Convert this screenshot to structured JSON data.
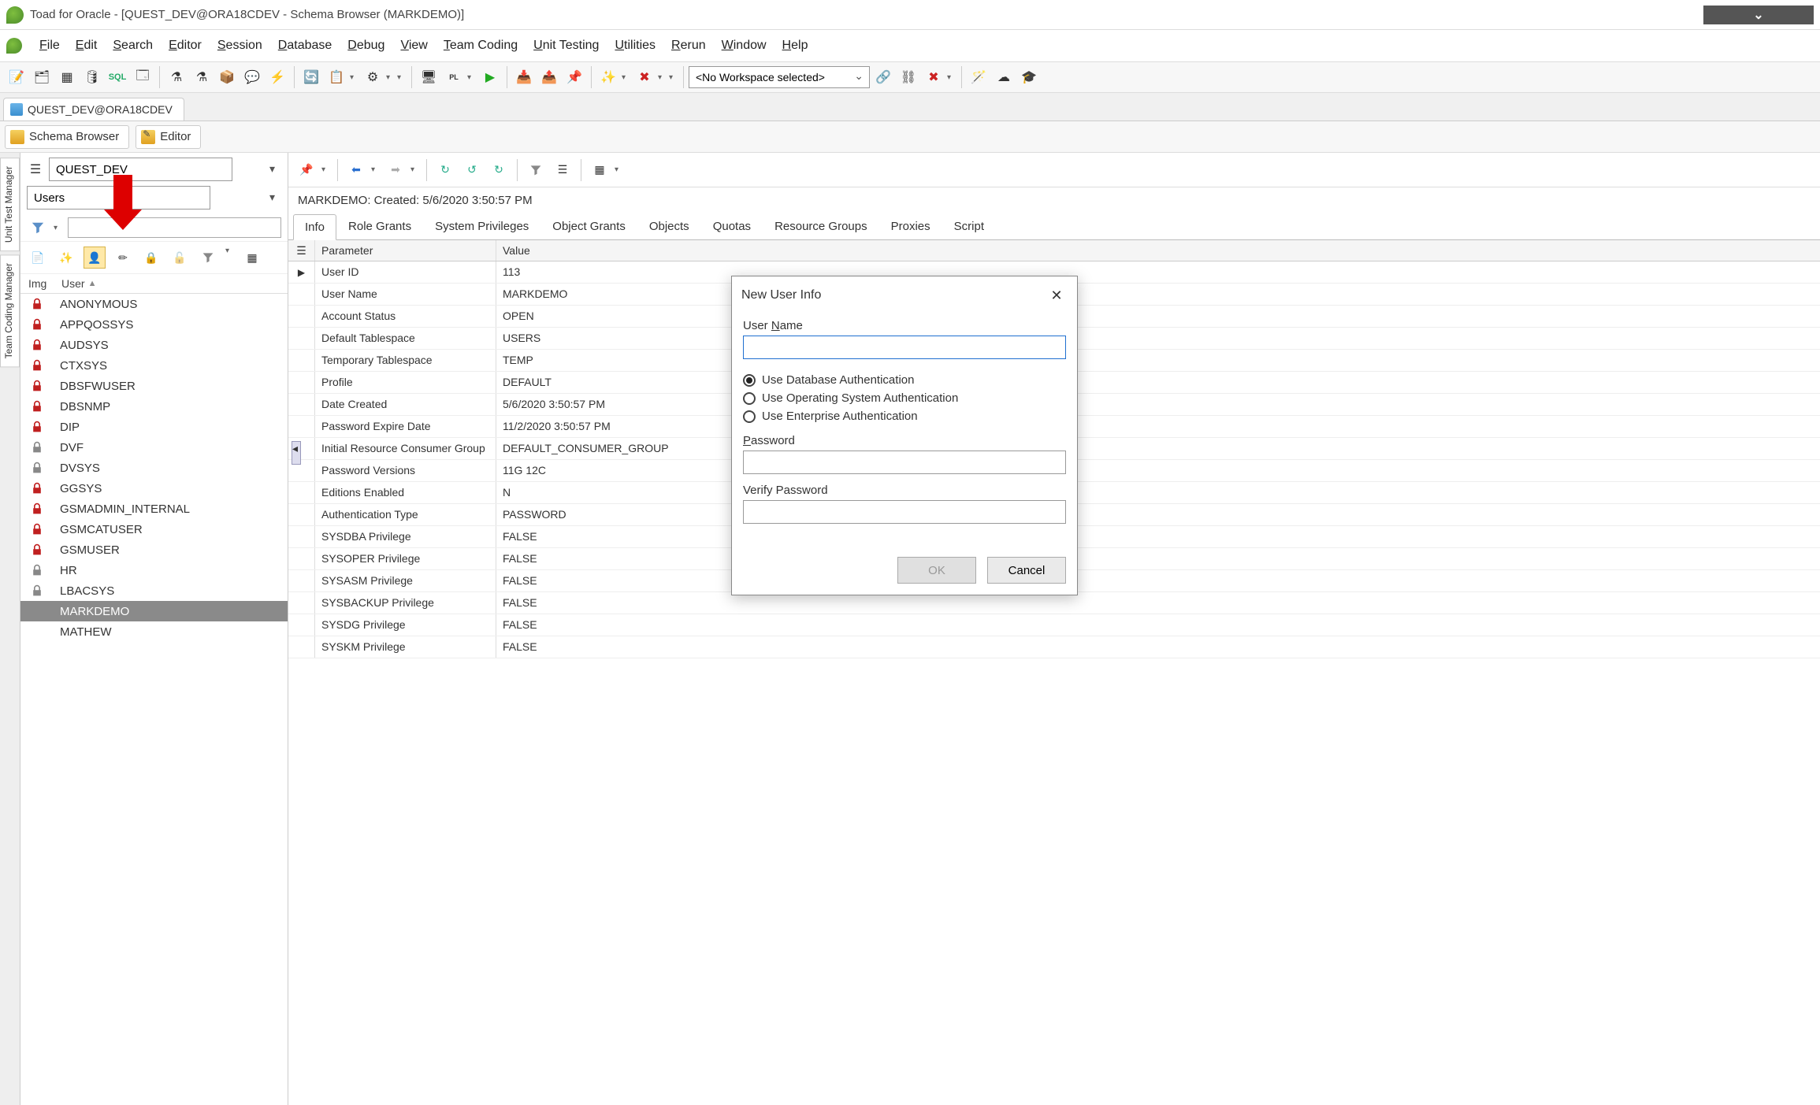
{
  "window": {
    "title": "Toad for Oracle - [QUEST_DEV@ORA18CDEV - Schema Browser (MARKDEMO)]"
  },
  "menu": [
    "File",
    "Edit",
    "Search",
    "Editor",
    "Session",
    "Database",
    "Debug",
    "View",
    "Team Coding",
    "Unit Testing",
    "Utilities",
    "Rerun",
    "Window",
    "Help"
  ],
  "workspace": {
    "selected": "<No Workspace selected>"
  },
  "connection_tab": "QUEST_DEV@ORA18CDEV",
  "sub_tabs": [
    "Schema Browser",
    "Editor"
  ],
  "side_tabs": [
    "Unit Test Manager",
    "Team Coding Manager"
  ],
  "left": {
    "schema_selected": "QUEST_DEV",
    "type_selected": "Users",
    "filter_value": "",
    "columns": {
      "img": "Img",
      "user": "User"
    },
    "users": [
      {
        "name": "ANONYMOUS",
        "lock": "red"
      },
      {
        "name": "APPQOSSYS",
        "lock": "red"
      },
      {
        "name": "AUDSYS",
        "lock": "red"
      },
      {
        "name": "CTXSYS",
        "lock": "red"
      },
      {
        "name": "DBSFWUSER",
        "lock": "red"
      },
      {
        "name": "DBSNMP",
        "lock": "red"
      },
      {
        "name": "DIP",
        "lock": "red"
      },
      {
        "name": "DVF",
        "lock": "gray"
      },
      {
        "name": "DVSYS",
        "lock": "gray"
      },
      {
        "name": "GGSYS",
        "lock": "red"
      },
      {
        "name": "GSMADMIN_INTERNAL",
        "lock": "red"
      },
      {
        "name": "GSMCATUSER",
        "lock": "red"
      },
      {
        "name": "GSMUSER",
        "lock": "red"
      },
      {
        "name": "HR",
        "lock": "gray"
      },
      {
        "name": "LBACSYS",
        "lock": "gray"
      },
      {
        "name": "MARKDEMO",
        "lock": "",
        "selected": true
      },
      {
        "name": "MATHEW",
        "lock": ""
      }
    ]
  },
  "right": {
    "status": "MARKDEMO:  Created: 5/6/2020 3:50:57 PM",
    "tabs": [
      "Info",
      "Role Grants",
      "System Privileges",
      "Object Grants",
      "Objects",
      "Quotas",
      "Resource Groups",
      "Proxies",
      "Script"
    ],
    "active_tab": "Info",
    "grid": {
      "header": {
        "param": "Parameter",
        "value": "Value"
      },
      "rows": [
        {
          "p": "User ID",
          "v": "113",
          "cur": true
        },
        {
          "p": "User Name",
          "v": "MARKDEMO"
        },
        {
          "p": "Account Status",
          "v": "OPEN"
        },
        {
          "p": "Default Tablespace",
          "v": "USERS"
        },
        {
          "p": "Temporary Tablespace",
          "v": "TEMP"
        },
        {
          "p": "Profile",
          "v": "DEFAULT"
        },
        {
          "p": "Date Created",
          "v": "5/6/2020 3:50:57 PM"
        },
        {
          "p": "Password Expire Date",
          "v": "11/2/2020 3:50:57 PM"
        },
        {
          "p": "Initial Resource Consumer Group",
          "v": "DEFAULT_CONSUMER_GROUP"
        },
        {
          "p": "Password Versions",
          "v": "11G 12C"
        },
        {
          "p": "Editions Enabled",
          "v": "N"
        },
        {
          "p": "Authentication Type",
          "v": "PASSWORD"
        },
        {
          "p": "SYSDBA Privilege",
          "v": "FALSE"
        },
        {
          "p": "SYSOPER Privilege",
          "v": "FALSE"
        },
        {
          "p": "SYSASM Privilege",
          "v": "FALSE"
        },
        {
          "p": "SYSBACKUP Privilege",
          "v": "FALSE"
        },
        {
          "p": "SYSDG Privilege",
          "v": "FALSE"
        },
        {
          "p": "SYSKM Privilege",
          "v": "FALSE"
        }
      ]
    }
  },
  "dialog": {
    "title": "New User Info",
    "username_label": "User Name",
    "username_value": "",
    "auth_options": [
      {
        "label": "Use Database Authentication",
        "checked": true
      },
      {
        "label": "Use Operating System Authentication",
        "checked": false
      },
      {
        "label": "Use Enterprise Authentication",
        "checked": false
      }
    ],
    "password_label": "Password",
    "verify_label": "Verify Password",
    "ok": "OK",
    "cancel": "Cancel"
  }
}
